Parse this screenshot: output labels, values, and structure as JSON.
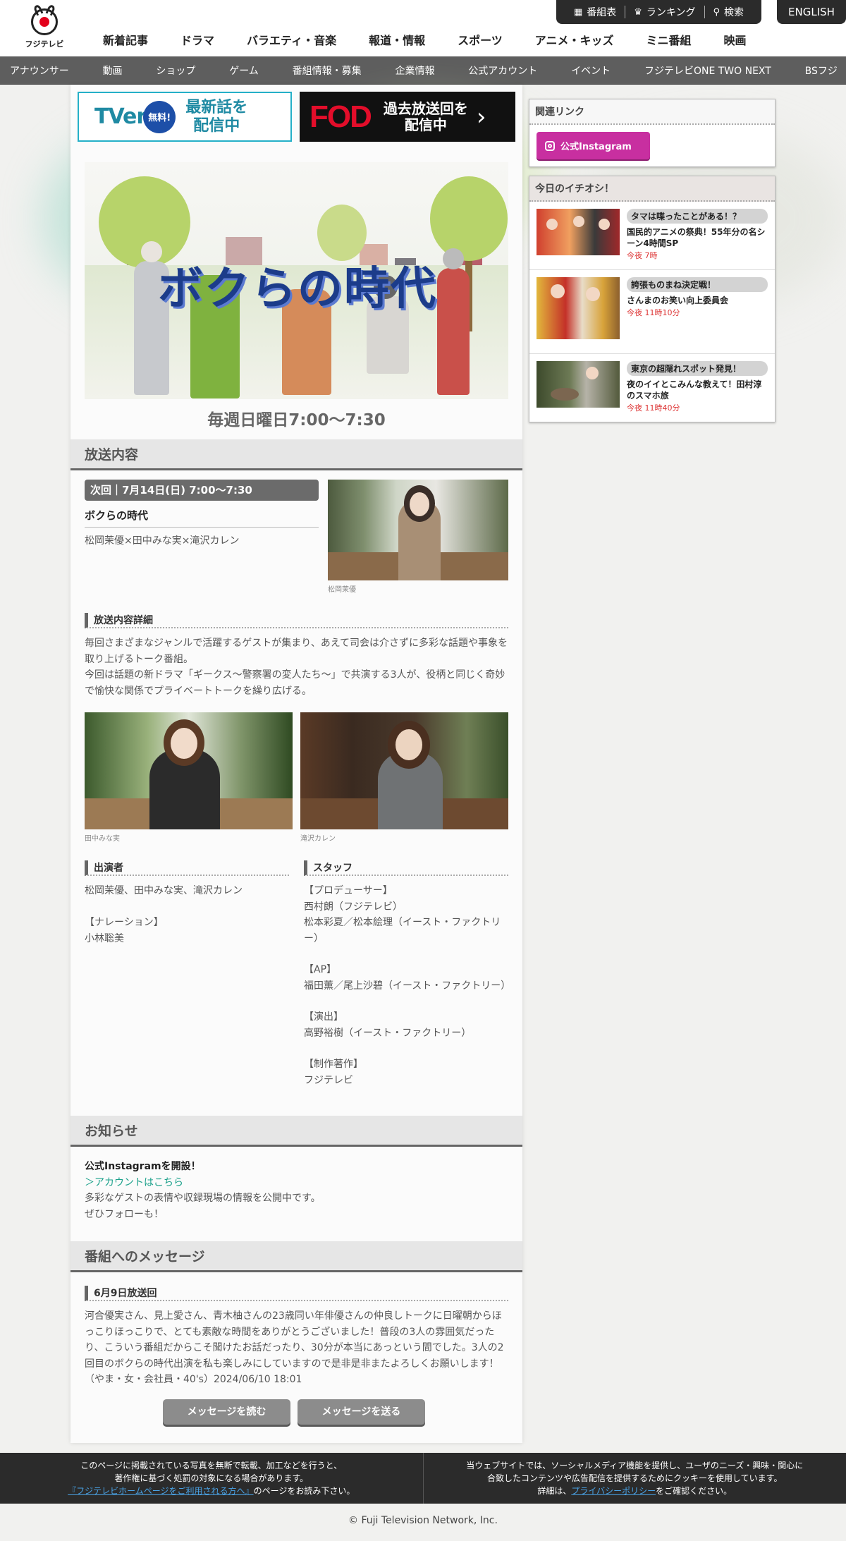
{
  "logo": {
    "name": "フジテレビ"
  },
  "utility": {
    "schedule": "番組表",
    "ranking": "ランキング",
    "search": "検索",
    "english": "ENGLISH"
  },
  "main_nav": [
    "新着記事",
    "ドラマ",
    "バラエティ・音楽",
    "報道・情報",
    "スポーツ",
    "アニメ・キッズ",
    "ミニ番組",
    "映画"
  ],
  "sub_nav": [
    "アナウンサー",
    "動画",
    "ショップ",
    "ゲーム",
    "番組情報・募集",
    "企業情報",
    "公式アカウント",
    "イベント",
    "フジテレビONE TWO NEXT",
    "BSフジ"
  ],
  "banners": {
    "tver": {
      "brand": "TVer",
      "badge": "無料!",
      "line1": "最新話を",
      "line2": "配信中"
    },
    "fod": {
      "brand": "FOD",
      "line1": "過去放送回を",
      "line2": "配信中"
    }
  },
  "program": {
    "title_art": "ボクらの時代",
    "airtime": "毎週日曜日7:00〜7:30"
  },
  "broadcast": {
    "heading": "放送内容",
    "next_pill": "次回｜7月14日(日) 7:00〜7:30",
    "next_title": "ボクらの時代",
    "next_guests": "松岡茉優×田中みな実×滝沢カレン",
    "photo_caption_1": "松岡茉優",
    "detail_heading": "放送内容詳細",
    "detail_text_1": "毎回さまざまなジャンルで活躍するゲストが集まり、あえて司会は介さずに多彩な話題や事象を取り上げるトーク番組。",
    "detail_text_2": "今回は話題の新ドラマ「ギークス〜警察署の変人たち〜」で共演する3人が、役柄と同じく奇妙で愉快な関係でプライベートトークを繰り広げる。",
    "photo_caption_2": "田中みな実",
    "photo_caption_3": "滝沢カレン"
  },
  "cast": {
    "heading": "出演者",
    "members": "松岡茉優、田中みな実、滝沢カレン",
    "narration_label": "【ナレーション】",
    "narration": "小林聡美"
  },
  "staff": {
    "heading": "スタッフ",
    "lines": [
      "【プロデューサー】",
      "西村朗（フジテレビ）",
      "松本彩夏／松本絵理（イースト・ファクトリー）",
      "",
      "【AP】",
      "福田薫／尾上沙碧（イースト・ファクトリー）",
      "",
      "【演出】",
      "高野裕樹（イースト・ファクトリー）",
      "",
      "【制作著作】",
      "フジテレビ"
    ]
  },
  "news": {
    "heading": "お知らせ",
    "title": "公式Instagramを開設！",
    "link": "＞アカウントはこちら",
    "line1": "多彩なゲストの表情や収録現場の情報を公開中です。",
    "line2": "ぜひフォローも！"
  },
  "messages": {
    "heading": "番組へのメッセージ",
    "sub": "6月9日放送回",
    "body": "河合優実さん、見上愛さん、青木柚さんの23歳同い年俳優さんの仲良しトークに日曜朝からほっこりほっこりで、とても素敵な時間をありがとうございました！普段の3人の雰囲気だったり、こういう番組だからこそ聞けたお話だったり、30分が本当にあっという間でした。3人の2回目のボクらの時代出演を私も楽しみにしていますので是非是非またよろしくお願いします！（やま・女・会社員・40's）2024/06/10 18:01",
    "read_button": "メッセージを読む",
    "send_button": "メッセージを送る"
  },
  "side": {
    "related_heading": "関連リンク",
    "instagram_button": "公式Instagram",
    "picks_heading": "今日のイチオシ！",
    "picks": [
      {
        "tag": "タマは喋ったことがある！？",
        "name": "国民的アニメの祭典！55年分の名シーン4時間SP",
        "time": "今夜 7時"
      },
      {
        "tag": "誇張ものまね決定戦！",
        "name": "さんまのお笑い向上委員会",
        "time": "今夜 11時10分"
      },
      {
        "tag": "東京の超隠れスポット発見！",
        "name": "夜のイイとこみんな教えて！田村淳のスマホ旅",
        "time": "今夜 11時40分"
      }
    ]
  },
  "footer": {
    "left_1": "このページに掲載されている写真を無断で転載、加工などを行うと、",
    "left_2": "著作権に基づく処罰の対象になる場合があります。",
    "left_link": "『フジテレビホームページをご利用される方へ』",
    "left_3": "のページをお読み下さい。",
    "right_1": "当ウェブサイトでは、ソーシャルメディア機能を提供し、ユーザのニーズ・興味・関心に",
    "right_2": "合致したコンテンツや広告配信を提供するためにクッキーを使用しています。",
    "right_3a": "詳細は、",
    "right_link": "プライバシーポリシー",
    "right_3b": "をご確認ください。",
    "copyright": "© Fuji Television Network, Inc."
  }
}
